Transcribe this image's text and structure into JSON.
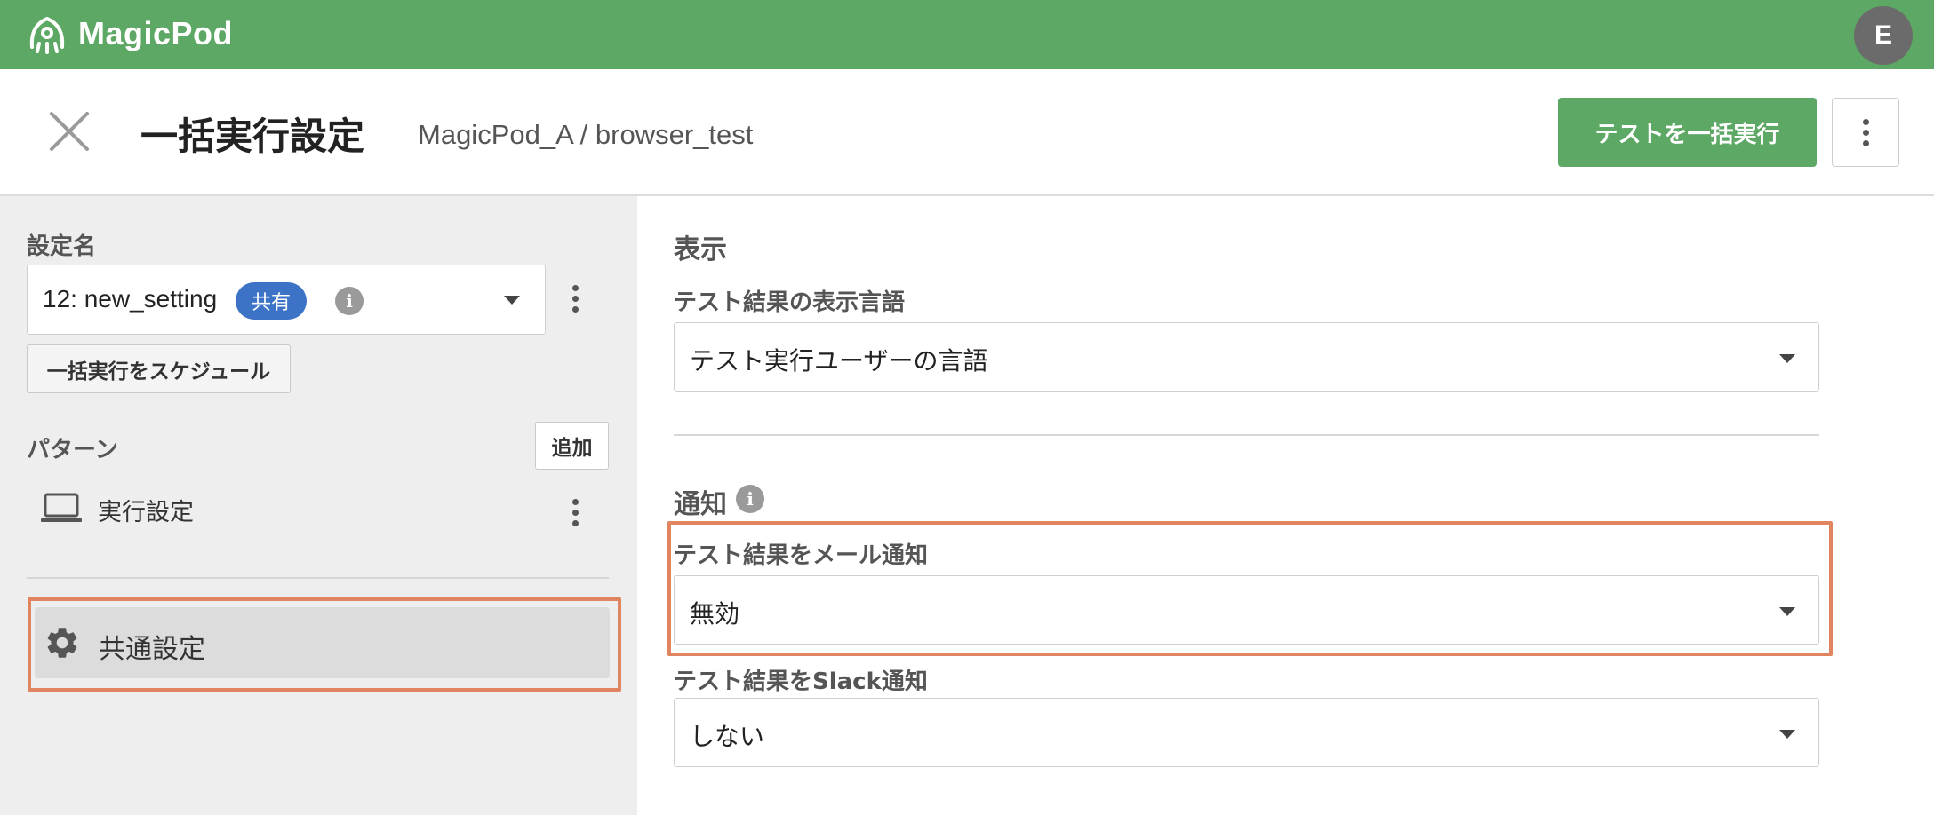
{
  "app": {
    "name": "MagicPod",
    "user_initial": "E"
  },
  "header": {
    "title": "一括実行設定",
    "breadcrumb": "MagicPod_A / browser_test",
    "run_button_label": "テストを一括実行"
  },
  "sidebar": {
    "setting_name_label": "設定名",
    "selected_setting": "12: new_setting",
    "shared_badge": "共有",
    "schedule_button_label": "一括実行をスケジュール",
    "pattern_label": "パターン",
    "add_button_label": "追加",
    "patterns": [
      {
        "label": "実行設定",
        "icon": "laptop-icon"
      }
    ],
    "common_settings_label": "共通設定"
  },
  "main": {
    "display_section": {
      "title": "表示",
      "language_label": "テスト結果の表示言語",
      "language_value": "テスト実行ユーザーの言語"
    },
    "notification_section": {
      "title": "通知",
      "email_label": "テスト結果をメール通知",
      "email_value": "無効",
      "slack_label": "テスト結果をSlack通知",
      "slack_value": "しない"
    }
  },
  "colors": {
    "brand_green": "#5ca864",
    "badge_blue": "#3d73c7",
    "highlight_orange": "#e0855f",
    "sidebar_bg": "#eeeeee"
  }
}
